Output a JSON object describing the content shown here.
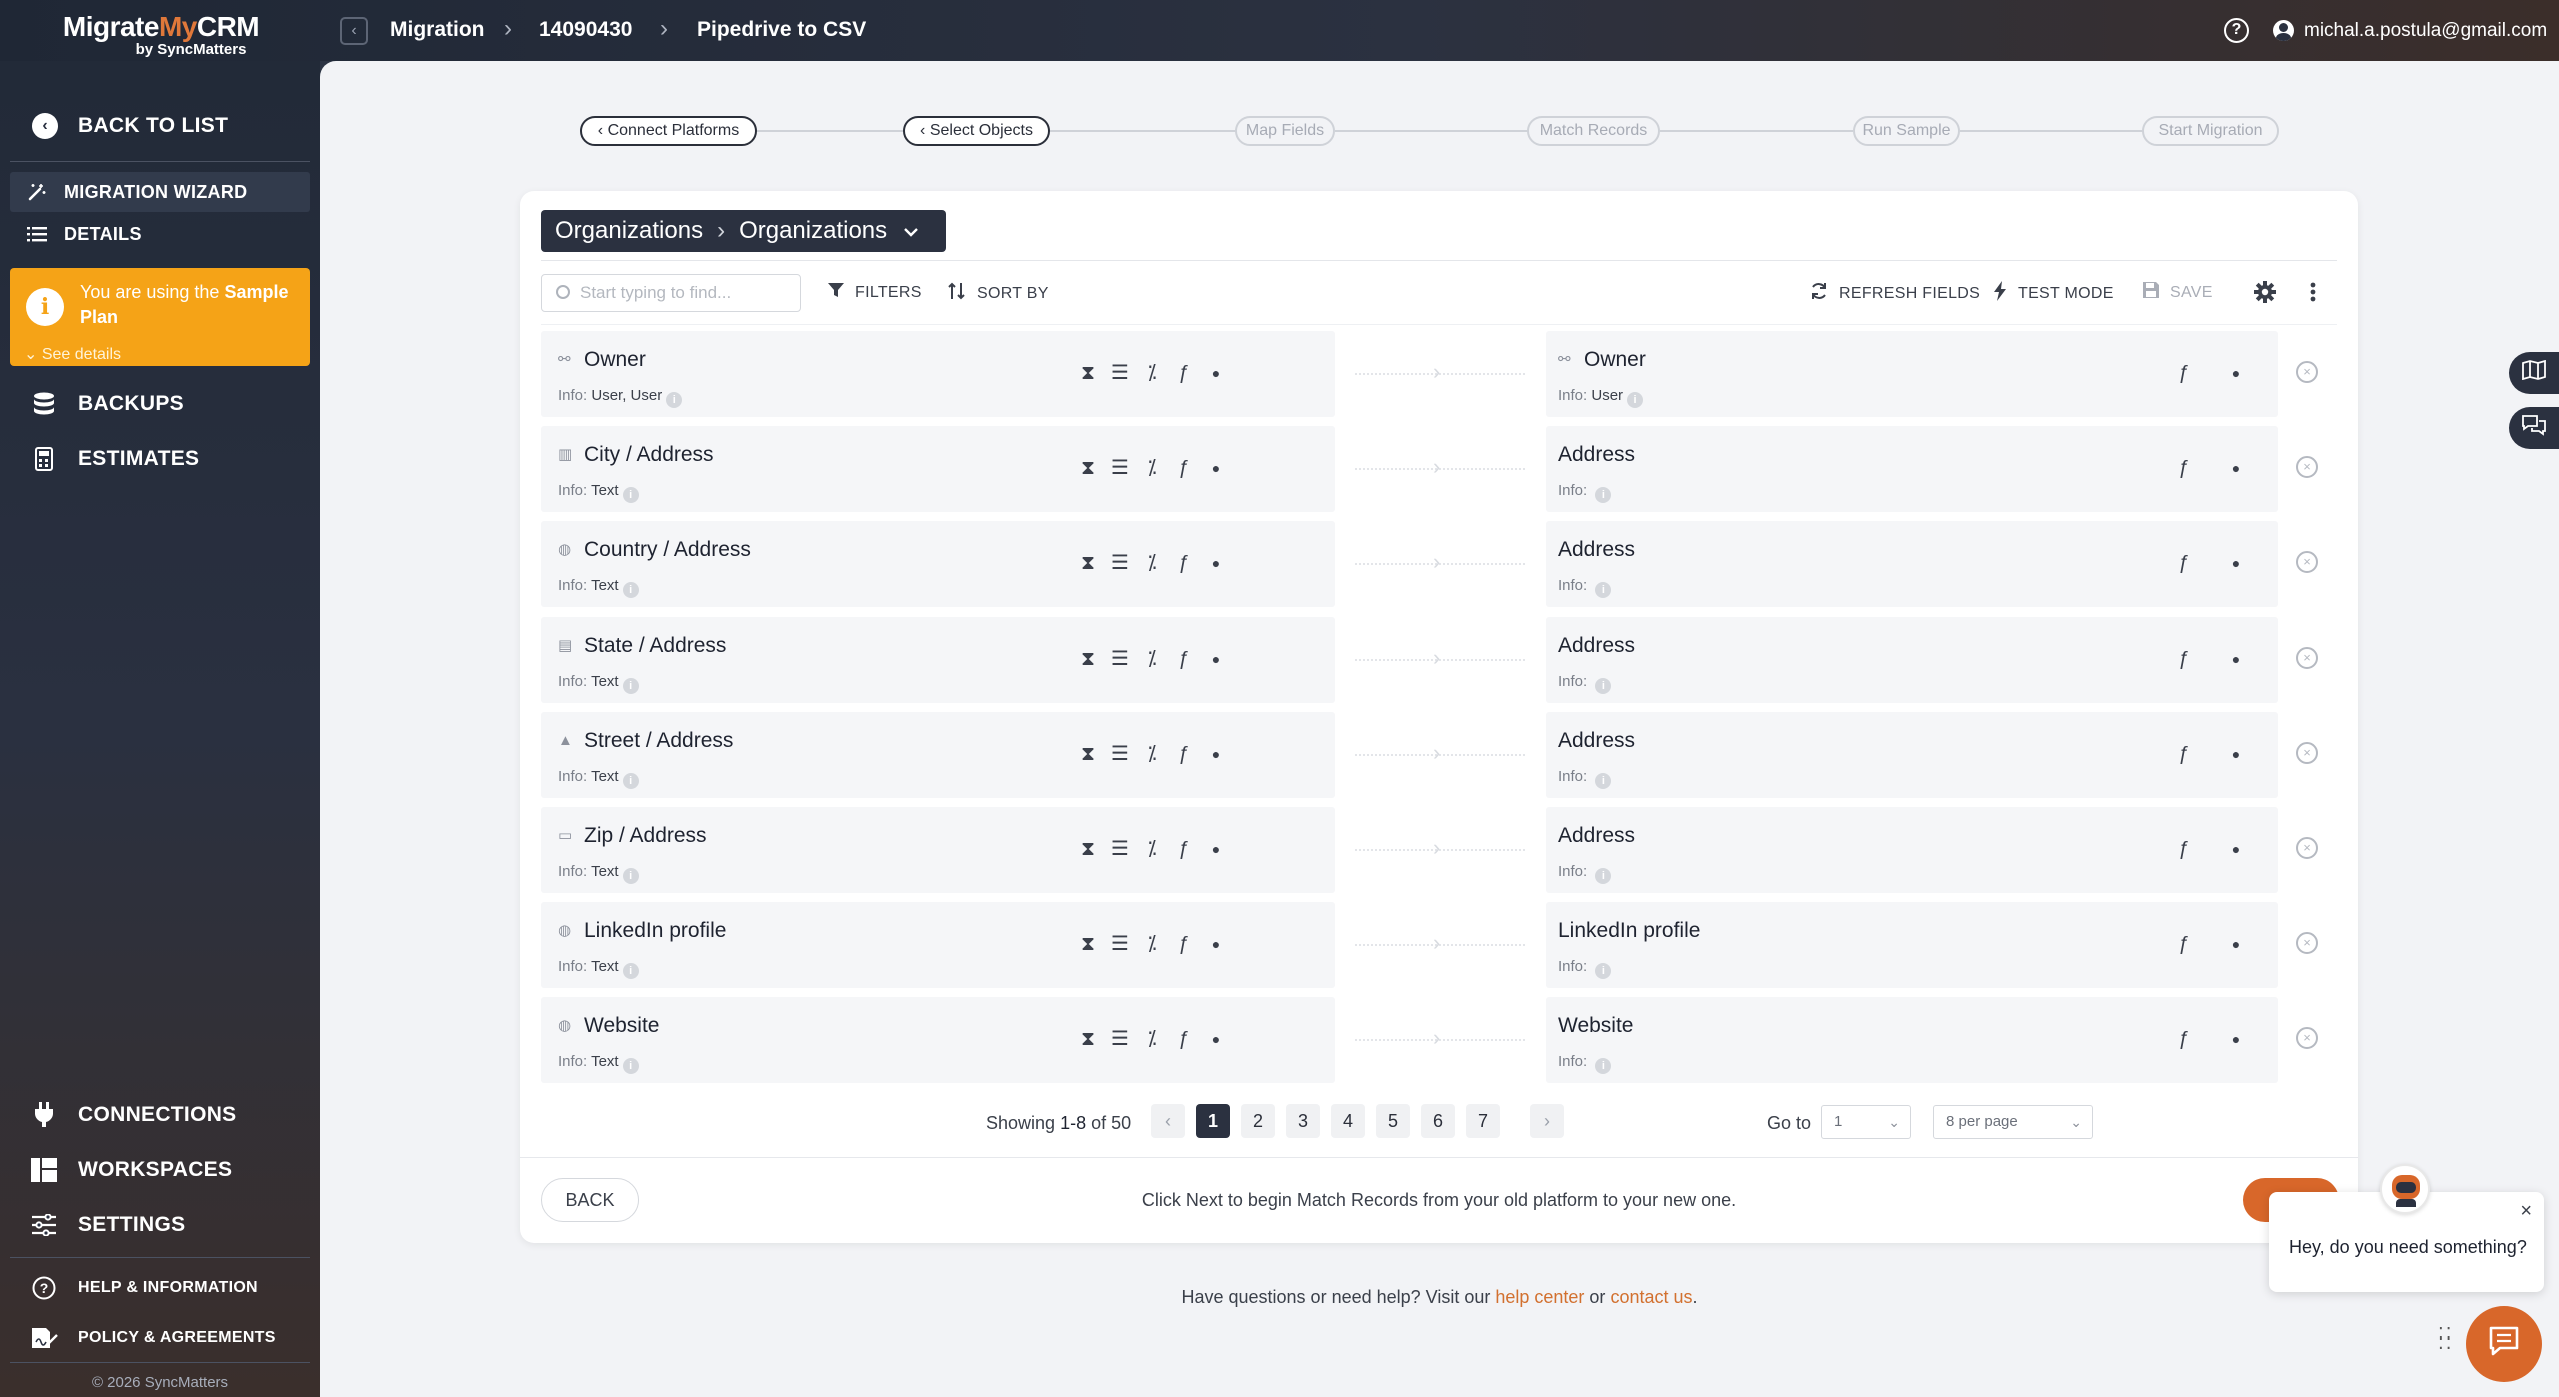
{
  "app": {
    "logo_part1": "Migrate",
    "logo_part2": "My",
    "logo_part3": "CRM",
    "logo_sub": "by SyncMatters",
    "accent_color": "#e0783a",
    "brand_dark": "#2b3140"
  },
  "header": {
    "breadcrumbs": [
      "Migration",
      "14090430",
      "Pipedrive to CSV"
    ],
    "user_email": "michal.a.postula@gmail.com"
  },
  "sidebar": {
    "back_label": "BACK TO LIST",
    "wizard_label": "MIGRATION WIZARD",
    "details_label": "DETAILS",
    "plan_notice_pre": "You are using the ",
    "plan_notice_bold": "Sample Plan",
    "plan_see_details": "See details",
    "backups_label": "BACKUPS",
    "estimates_label": "ESTIMATES",
    "connections_label": "CONNECTIONS",
    "workspaces_label": "WORKSPACES",
    "settings_label": "SETTINGS",
    "help_label": "HELP & INFORMATION",
    "policy_label": "POLICY & AGREEMENTS",
    "copyright": "© 2026 SyncMatters"
  },
  "stepper": {
    "steps": [
      "Connect Platforms",
      "Select Objects",
      "Map Fields",
      "Match Records",
      "Run Sample",
      "Start Migration"
    ]
  },
  "toolbar": {
    "object_source": "Organizations",
    "object_target": "Organizations",
    "search_placeholder": "Start typing to find...",
    "filters": "FILTERS",
    "sort_by": "SORT BY",
    "refresh_fields": "REFRESH FIELDS",
    "test_mode": "TEST MODE",
    "save": "SAVE"
  },
  "mapping": {
    "info_label": "Info:",
    "rows": [
      {
        "src_name": "Owner",
        "src_info": "User, User",
        "dst_name": "Owner",
        "dst_info": "User",
        "src_icon": "hierarchy-icon",
        "dst_icon": "hierarchy-icon"
      },
      {
        "src_name": "City / Address",
        "src_info": "Text",
        "dst_name": "Address",
        "dst_info": "",
        "src_icon": "city-icon"
      },
      {
        "src_name": "Country / Address",
        "src_info": "Text",
        "dst_name": "Address",
        "dst_info": "",
        "src_icon": "globe-icon"
      },
      {
        "src_name": "State / Address",
        "src_info": "Text",
        "dst_name": "Address",
        "dst_info": "",
        "src_icon": "map-icon"
      },
      {
        "src_name": "Street / Address",
        "src_info": "Text",
        "dst_name": "Address",
        "dst_info": "",
        "src_icon": "road-icon"
      },
      {
        "src_name": "Zip / Address",
        "src_info": "Text",
        "dst_name": "Address",
        "dst_info": "",
        "src_icon": "mailbox-icon"
      },
      {
        "src_name": "LinkedIn profile",
        "src_info": "Text",
        "dst_name": "LinkedIn profile",
        "dst_info": "",
        "src_icon": "web-icon"
      },
      {
        "src_name": "Website",
        "src_info": "Text",
        "dst_name": "Website",
        "dst_info": "",
        "src_icon": "web-icon"
      }
    ]
  },
  "pagination": {
    "showing_prefix": "Showing ",
    "showing_range": "1-8",
    "showing_suffix": " of 50",
    "pages": [
      "1",
      "2",
      "3",
      "4",
      "5",
      "6",
      "7"
    ],
    "current_page": "1",
    "goto_label": "Go to",
    "goto_value": "1",
    "per_page": "8 per page"
  },
  "footer": {
    "back_button": "BACK",
    "message": "Click Next to begin Match Records from your old platform to your new one.",
    "help_pre": "Have questions or need help? Visit our ",
    "help_link": "help center",
    "help_mid": " or ",
    "contact_link": "contact us",
    "help_end": "."
  },
  "chat": {
    "greeting": "Hey, do you need something?"
  }
}
